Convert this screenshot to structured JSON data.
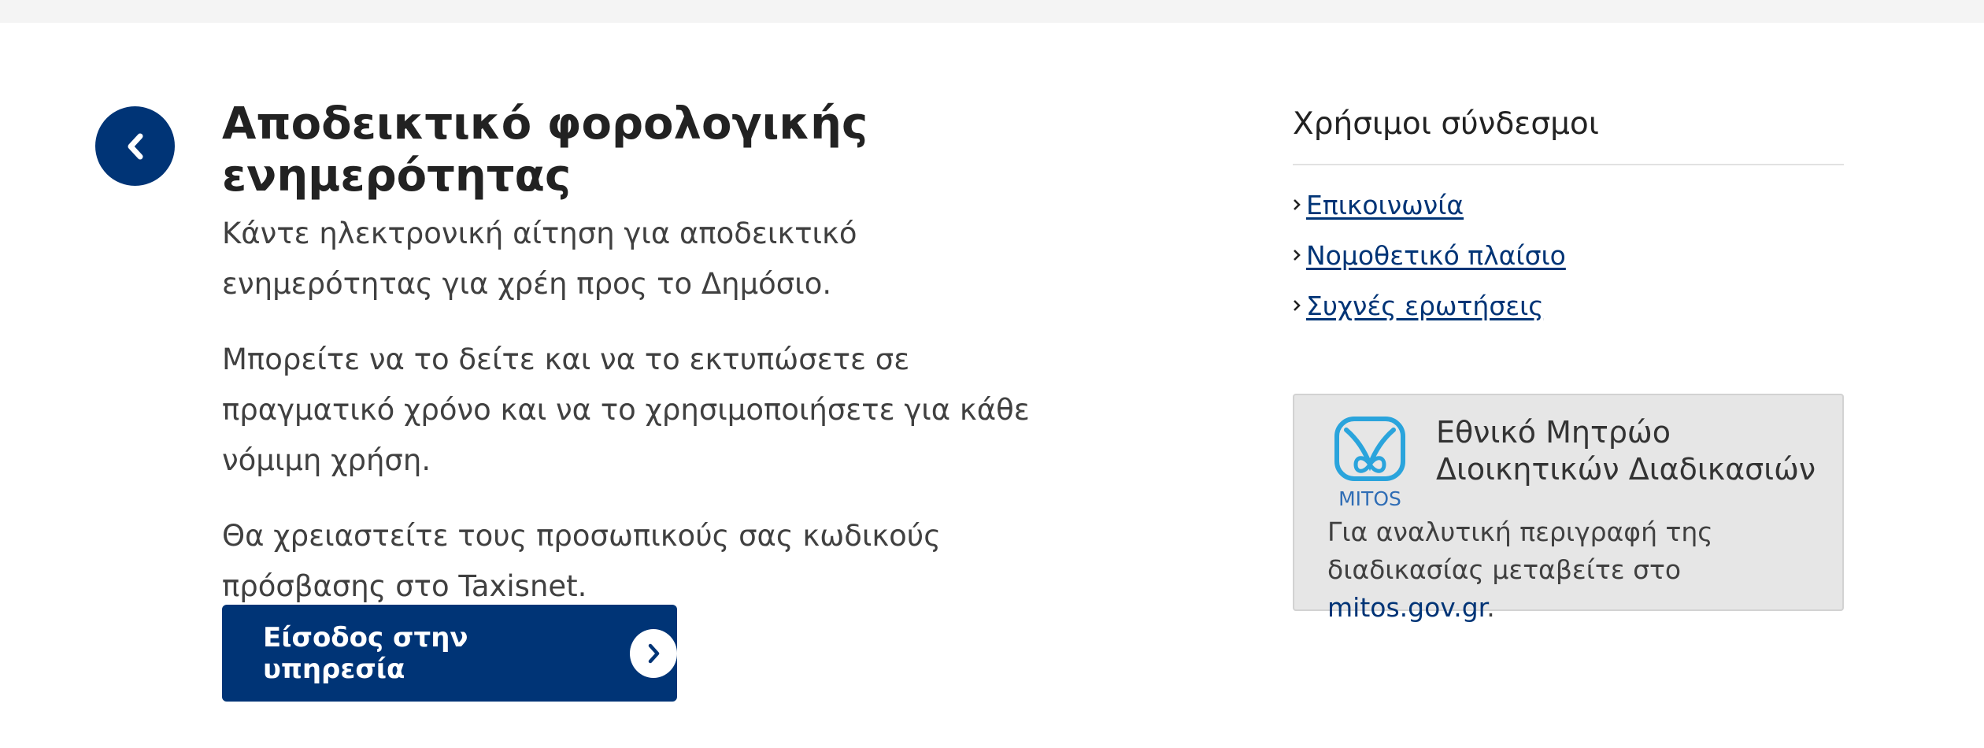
{
  "back_button": {
    "icon": "chevron-left-icon"
  },
  "main": {
    "title": "Αποδεικτικό φορολογικής ενημερότητας",
    "paragraphs": [
      "Κάντε ηλεκτρονική αίτηση για αποδεικτικό ενημερότητας για χρέη προς το Δημόσιο.",
      "Μπορείτε να το δείτε και να το εκτυπώσετε σε πραγματικό χρόνο και να το χρησιμοποιήσετε για κάθε νόμιμη χρήση.",
      "Θα χρειαστείτε τους προσωπικούς σας κωδικούς πρόσβασης στο Taxisnet."
    ],
    "cta_label": "Είσοδος στην υπηρεσία",
    "cta_icon": "chevron-right-circle-icon"
  },
  "sidebar": {
    "heading": "Χρήσιμοι σύνδεσμοι",
    "links": [
      {
        "label": "Επικοινωνία"
      },
      {
        "label": "Νομοθετικό πλαίσιο"
      },
      {
        "label": "Συχνές ερωτήσεις"
      }
    ]
  },
  "mitos": {
    "logo_text": "MITOS",
    "title": "Εθνικό Μητρώο Διοικητικών Διαδικασιών",
    "desc_prefix": "Για αναλυτική περιγραφή της διαδικασίας μεταβείτε στο ",
    "link_text": "mitos.gov.gr",
    "desc_suffix": "."
  },
  "colors": {
    "brand": "#003476",
    "mitos_blue": "#2aa4dc",
    "card_background": "#e6e6e6"
  }
}
